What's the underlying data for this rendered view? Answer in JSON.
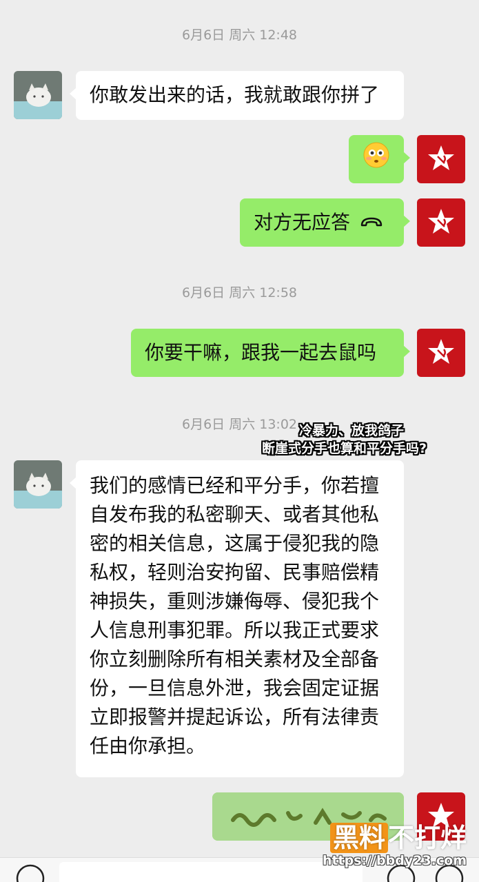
{
  "timestamps": [
    "6月6日 周六 12:48",
    "6月6日 周六 12:58",
    "6月6日 周六 13:02"
  ],
  "messages": [
    {
      "side": "left",
      "text": "你敢发出来的话，我就敢跟你拼了"
    },
    {
      "side": "right",
      "text": "😳",
      "icon": "flushed-face-emoji"
    },
    {
      "side": "right",
      "text": "对方无应答",
      "icon": "hang-up-icon"
    },
    {
      "side": "right",
      "text": "你要干嘛，跟我一起去鼠吗"
    },
    {
      "side": "left",
      "lines": [
        "我们的感情已经和平分手，你若擅",
        "自发布我的私密聊天、或者其他私",
        "密的相关信息，这属于侵犯我的隐",
        "私权，轻则治安拘留、民事赔偿精",
        "神损失，重则涉嫌侮辱、侵犯我个",
        "人信息刑事犯罪。所以我正式要求",
        "你立刻删除所有相关素材及全部备",
        "份，一旦信息外泄，我会固定证据",
        "立即报警并提起诉讼，所有法律责",
        "任由你承担。"
      ]
    },
    {
      "side": "right",
      "text": "",
      "kind": "sticker"
    }
  ],
  "overlay_caption": {
    "line1": "冷暴力、放我鸽子",
    "line2": "断崖式分手也算和平分手吗?"
  },
  "watermark": {
    "brand_hl": "黑料",
    "brand_rest": "不打烊",
    "url": "https://bbdy23.com"
  },
  "self_avatar_icon": "star-emblem-icon",
  "colors": {
    "background": "#ededed",
    "self_bubble": "#95ec69",
    "other_bubble": "#ffffff",
    "self_avatar": "#c8141b",
    "watermark_orange": "#f29318"
  }
}
